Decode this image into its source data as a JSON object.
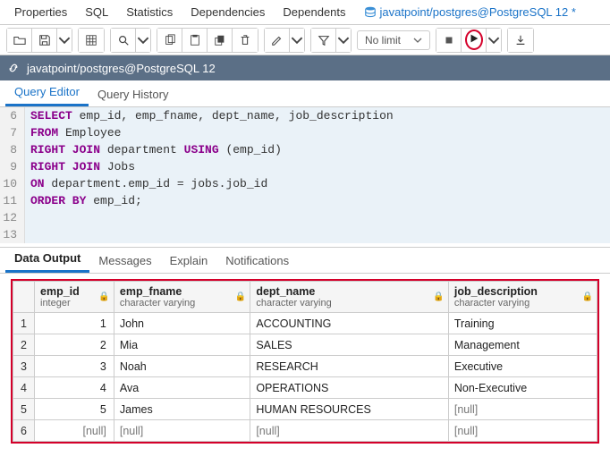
{
  "top_tabs": {
    "properties": "Properties",
    "sql": "SQL",
    "statistics": "Statistics",
    "dependencies": "Dependencies",
    "dependents": "Dependents",
    "connection": "javatpoint/postgres@PostgreSQL 12 *"
  },
  "toolbar": {
    "nolimit": "No limit"
  },
  "connbar": {
    "label": "javatpoint/postgres@PostgreSQL 12"
  },
  "inner_tabs": {
    "editor": "Query Editor",
    "history": "Query History"
  },
  "editor_lines": [
    {
      "n": "6",
      "tokens": [
        {
          "t": "SELECT",
          "c": "kw"
        },
        {
          "t": " emp_id, emp_fname, dept_name, job_description",
          "c": "id"
        }
      ]
    },
    {
      "n": "7",
      "tokens": [
        {
          "t": "FROM",
          "c": "kw"
        },
        {
          "t": " Employee",
          "c": "id"
        }
      ]
    },
    {
      "n": "8",
      "tokens": [
        {
          "t": "RIGHT JOIN",
          "c": "kw"
        },
        {
          "t": " department ",
          "c": "id"
        },
        {
          "t": "USING",
          "c": "kw"
        },
        {
          "t": " (emp_id)",
          "c": "id"
        }
      ]
    },
    {
      "n": "9",
      "tokens": [
        {
          "t": "RIGHT JOIN",
          "c": "kw"
        },
        {
          "t": " Jobs",
          "c": "id"
        }
      ]
    },
    {
      "n": "10",
      "tokens": [
        {
          "t": "ON",
          "c": "kw"
        },
        {
          "t": " department.emp_id = jobs.job_id",
          "c": "id"
        }
      ]
    },
    {
      "n": "11",
      "tokens": [
        {
          "t": "ORDER BY",
          "c": "kw"
        },
        {
          "t": " emp_id;",
          "c": "id"
        }
      ]
    },
    {
      "n": "12",
      "tokens": []
    },
    {
      "n": "13",
      "tokens": []
    }
  ],
  "output_tabs": {
    "data": "Data Output",
    "messages": "Messages",
    "explain": "Explain",
    "notifications": "Notifications"
  },
  "columns": [
    {
      "name": "emp_id",
      "type": "integer"
    },
    {
      "name": "emp_fname",
      "type": "character varying"
    },
    {
      "name": "dept_name",
      "type": "character varying"
    },
    {
      "name": "job_description",
      "type": "character varying"
    }
  ],
  "rows": [
    {
      "n": "1",
      "emp_id": "1",
      "emp_fname": "John",
      "dept_name": "ACCOUNTING",
      "job_description": "Training"
    },
    {
      "n": "2",
      "emp_id": "2",
      "emp_fname": "Mia",
      "dept_name": "SALES",
      "job_description": "Management"
    },
    {
      "n": "3",
      "emp_id": "3",
      "emp_fname": "Noah",
      "dept_name": "RESEARCH",
      "job_description": "Executive"
    },
    {
      "n": "4",
      "emp_id": "4",
      "emp_fname": "Ava",
      "dept_name": "OPERATIONS",
      "job_description": "Non-Executive"
    },
    {
      "n": "5",
      "emp_id": "5",
      "emp_fname": "James",
      "dept_name": "HUMAN RESOURCES",
      "job_description": "[null]"
    },
    {
      "n": "6",
      "emp_id": "[null]",
      "emp_fname": "[null]",
      "dept_name": "[null]",
      "job_description": "[null]"
    }
  ]
}
